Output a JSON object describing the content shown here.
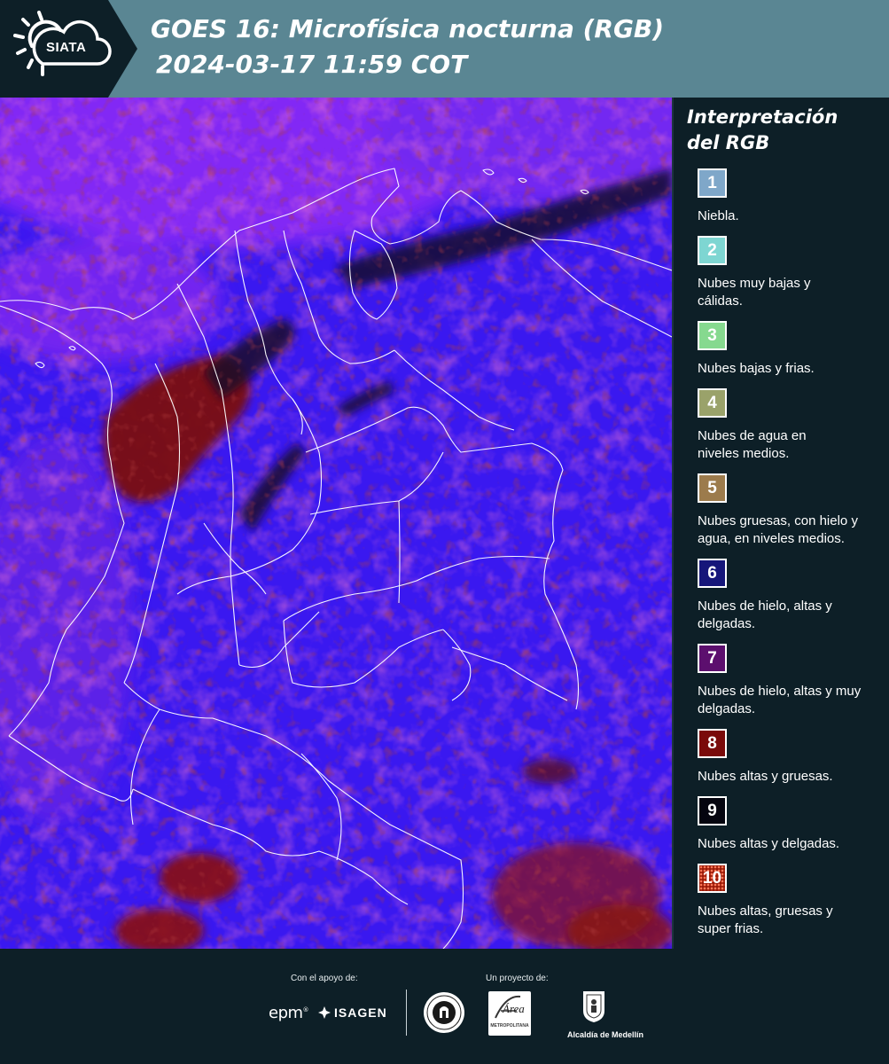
{
  "header": {
    "logo_text": "SIATA",
    "title_line1": "GOES 16: Microfísica nocturna (RGB)",
    "title_line2": "2024-03-17 11:59 COT"
  },
  "legend": {
    "title_line1": "Interpretación",
    "title_line2": "del RGB",
    "items": [
      {
        "number": "1",
        "label": "Niebla.",
        "color": "#7fa7c9"
      },
      {
        "number": "2",
        "label": "Nubes muy bajas y cálidas.",
        "color": "#7ed6d2"
      },
      {
        "number": "3",
        "label": "Nubes bajas y frias.",
        "color": "#86d98f"
      },
      {
        "number": "4",
        "label": "Nubes de agua en niveles medios.",
        "color": "#9aa26a"
      },
      {
        "number": "5",
        "label": "Nubes gruesas, con hielo y agua, en niveles medios.",
        "color": "#9c7b4c"
      },
      {
        "number": "6",
        "label": "Nubes de hielo, altas y delgadas.",
        "color": "#16167a"
      },
      {
        "number": "7",
        "label": "Nubes de hielo, altas y muy delgadas.",
        "color": "#5c0f6e"
      },
      {
        "number": "8",
        "label": "Nubes altas y gruesas.",
        "color": "#7a0a0a"
      },
      {
        "number": "9",
        "label": "Nubes altas y delgadas.",
        "color": "#05050f"
      },
      {
        "number": "10",
        "label": "Nubes altas, gruesas y super frias.",
        "color": "#9a1a08"
      }
    ]
  },
  "footer": {
    "support_label": "Con el apoyo de:",
    "project_label": "Un proyecto de:",
    "epm": "epm",
    "isagen": "ISAGEN",
    "area_logo": "METROPOLITANA",
    "medellin": "Alcaldía de Medellín"
  },
  "colors": {
    "background_dark": "#0d1f27",
    "header_bar": "#5a8693",
    "map_blue": "#3a14f0",
    "map_purple": "#8a2af5",
    "map_magenta": "#c0308a",
    "map_dark_red": "#7a0d0d"
  }
}
